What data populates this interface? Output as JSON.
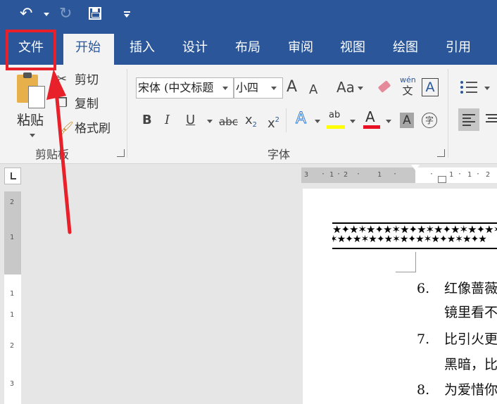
{
  "quick_access": {
    "undo_icon": "undo-arrow",
    "redo_icon": "redo-arrow",
    "save_icon": "floppy-disk",
    "customize_icon": "caret-down"
  },
  "tabs": [
    {
      "label": "文件"
    },
    {
      "label": "开始"
    },
    {
      "label": "插入"
    },
    {
      "label": "设计"
    },
    {
      "label": "布局"
    },
    {
      "label": "审阅"
    },
    {
      "label": "视图"
    },
    {
      "label": "绘图"
    },
    {
      "label": "引用"
    }
  ],
  "clipboard": {
    "paste_label": "粘贴",
    "cut_label": "剪切",
    "copy_label": "复制",
    "format_painter_label": "格式刷",
    "group_label": "剪贴板"
  },
  "font": {
    "font_name": "宋体 (中文标题",
    "font_size": "小四",
    "group_label": "字体",
    "grow_label": "A",
    "shrink_label": "A",
    "case_label": "Aa",
    "phonetic_top": "wén",
    "phonetic_bottom": "文",
    "border_label": "A",
    "bold_label": "B",
    "italic_label": "I",
    "underline_label": "U",
    "strike_label": "abc",
    "subscript_label": "x",
    "subscript_sub": "2",
    "superscript_label": "x",
    "superscript_sup": "2",
    "effects_label": "A",
    "highlight_label": "ab",
    "color_label": "A",
    "shading_label": "A",
    "enclose_label": "字",
    "highlight_color": "#ffff00",
    "font_color": "#e81123"
  },
  "ruler": {
    "h_ticks": [
      "3",
      "1",
      "2",
      "1",
      "1",
      "1",
      "2"
    ],
    "v_ticks": [
      "2",
      "1",
      "1",
      "1",
      "2",
      "3"
    ]
  },
  "document": {
    "list": [
      {
        "num": "6.",
        "line1": "红像蔷薇",
        "line2": "镜里看不"
      },
      {
        "num": "7.",
        "line1": "比引火更",
        "line2": "黑暗，比"
      },
      {
        "num": "8.",
        "line1": "为爱惜你",
        "line2": ""
      }
    ]
  },
  "colors": {
    "brand": "#2b579a",
    "annotation": "#e8202a"
  }
}
